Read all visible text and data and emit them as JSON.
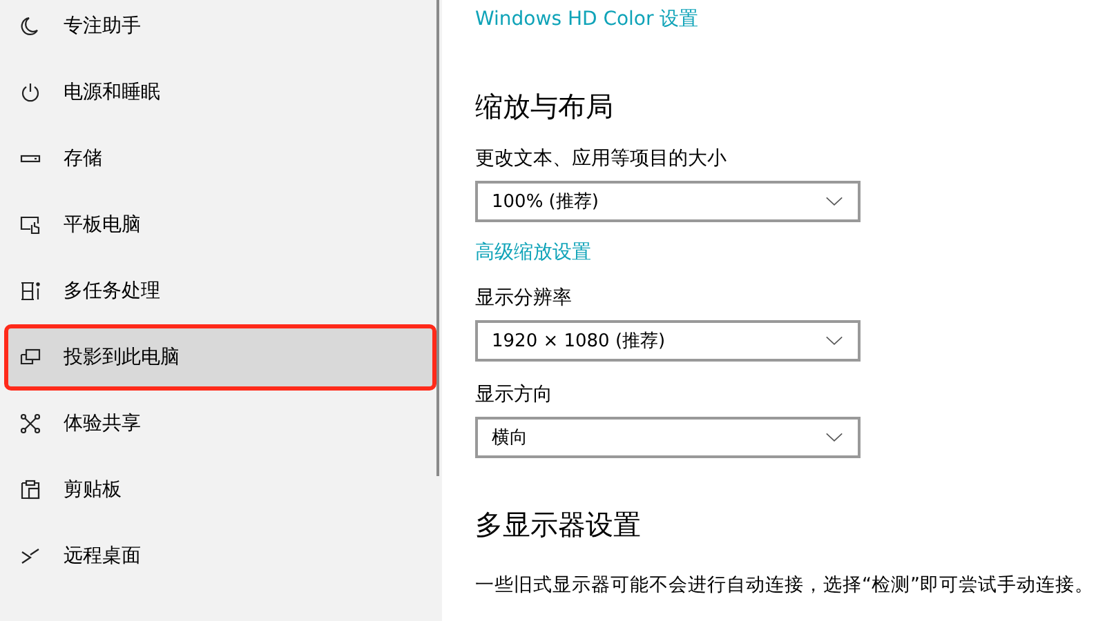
{
  "sidebar": {
    "items": [
      {
        "kind": "moon",
        "label": "专注助手",
        "selected": false
      },
      {
        "kind": "power",
        "label": "电源和睡眠",
        "selected": false
      },
      {
        "kind": "storage",
        "label": "存储",
        "selected": false
      },
      {
        "kind": "tablet",
        "label": "平板电脑",
        "selected": false
      },
      {
        "kind": "multitask",
        "label": "多任务处理",
        "selected": false
      },
      {
        "kind": "project",
        "label": "投影到此电脑",
        "selected": true
      },
      {
        "kind": "share",
        "label": "体验共享",
        "selected": false
      },
      {
        "kind": "clipboard",
        "label": "剪贴板",
        "selected": false
      },
      {
        "kind": "remote",
        "label": "远程桌面",
        "selected": false
      }
    ]
  },
  "content": {
    "hd_color_link": "Windows HD Color 设置",
    "scale_section": {
      "heading": "缩放与布局",
      "scale_label": "更改文本、应用等项目的大小",
      "scale_value": "100% (推荐)",
      "advanced_link": "高级缩放设置",
      "resolution_label": "显示分辨率",
      "resolution_value": "1920 × 1080 (推荐)",
      "orientation_label": "显示方向",
      "orientation_value": "横向"
    },
    "multi_section": {
      "heading": "多显示器设置",
      "description": "一些旧式显示器可能不会进行自动连接，选择“检测”即可尝试手动连接。"
    }
  }
}
